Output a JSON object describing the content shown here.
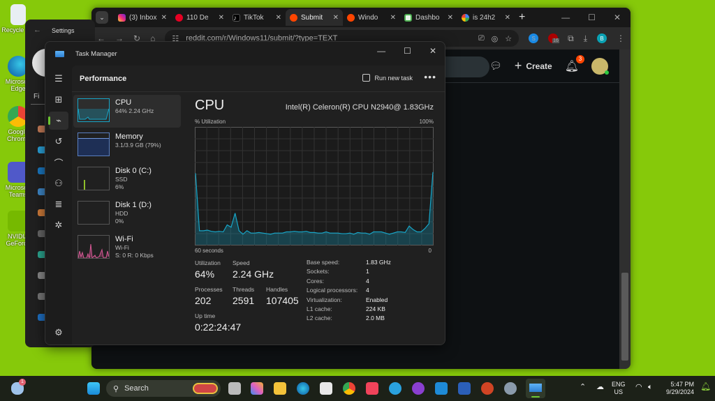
{
  "desktop": {
    "icons": [
      {
        "label": "Recycle Bin",
        "icon": "recycle-bin-icon"
      },
      {
        "label": "Microsoft Edge",
        "icon": "edge-icon"
      },
      {
        "label": "Google Chrome",
        "icon": "chrome-icon"
      },
      {
        "label": "Microsoft Teams",
        "icon": "teams-icon"
      },
      {
        "label": "NVIDIA GeForce",
        "icon": "nvidia-icon"
      }
    ]
  },
  "browser": {
    "tabs": [
      {
        "label": "(3) Inbox",
        "favicon": "instagram-icon",
        "color": "#d6249f"
      },
      {
        "label": "110 De",
        "favicon": "pinterest-icon",
        "color": "#e60023"
      },
      {
        "label": "TikTok",
        "favicon": "tiktok-icon",
        "color": "#111111"
      },
      {
        "label": "Submit",
        "favicon": "reddit-icon",
        "color": "#ff4500",
        "active": true
      },
      {
        "label": "Windo",
        "favicon": "reddit-icon",
        "color": "#ff4500"
      },
      {
        "label": "Dashbo",
        "favicon": "dashboard-icon",
        "color": "#4caf50"
      },
      {
        "label": "is 24h2",
        "favicon": "google-icon",
        "color": "#4285f4"
      }
    ],
    "new_tab": "+",
    "url": "reddit.com/r/Windows11/submit/?type=TEXT",
    "extension_badge": "16",
    "profile_initial": "B",
    "reddit": {
      "create_label": "Create",
      "notification_count": "3"
    }
  },
  "settings_window": {
    "title": "Settings",
    "search_partial": "Fi"
  },
  "task_manager": {
    "title": "Task Manager",
    "section": "Performance",
    "run_new_task": "Run new task",
    "more": "•••",
    "resources": [
      {
        "name": "CPU",
        "sub1": "64%  2.24 GHz",
        "sub2": "",
        "selected": true
      },
      {
        "name": "Memory",
        "sub1": "3.1/3.9 GB (79%)",
        "sub2": ""
      },
      {
        "name": "Disk 0 (C:)",
        "sub1": "SSD",
        "sub2": "6%"
      },
      {
        "name": "Disk 1 (D:)",
        "sub1": "HDD",
        "sub2": "0%"
      },
      {
        "name": "Wi-Fi",
        "sub1": "Wi-Fi",
        "sub2": "S: 0  R: 0 Kbps"
      }
    ],
    "detail": {
      "title": "CPU",
      "cpu_model": "Intel(R) Celeron(R) CPU N2940@ 1.83GHz",
      "y_label": "% Utilization",
      "y_max_label": "100%",
      "x_left_label": "60 seconds",
      "x_right_label": "0",
      "stats": {
        "utilization_label": "Utilization",
        "utilization": "64%",
        "speed_label": "Speed",
        "speed": "2.24 GHz",
        "processes_label": "Processes",
        "processes": "202",
        "threads_label": "Threads",
        "threads": "2591",
        "handles_label": "Handles",
        "handles": "107405",
        "uptime_label": "Up time",
        "uptime": "0:22:24:47"
      },
      "specs": [
        {
          "k": "Base speed:",
          "v": "1.83 GHz"
        },
        {
          "k": "Sockets:",
          "v": "1"
        },
        {
          "k": "Cores:",
          "v": "4"
        },
        {
          "k": "Logical processors:",
          "v": "4"
        },
        {
          "k": "Virtualization:",
          "v": "Enabled"
        },
        {
          "k": "L1 cache:",
          "v": "224 KB"
        },
        {
          "k": "L2 cache:",
          "v": "2.0 MB"
        }
      ]
    }
  },
  "chart_data": {
    "type": "area",
    "title": "CPU % Utilization",
    "xlabel": "60 seconds",
    "ylabel": "% Utilization",
    "ylim": [
      0,
      100
    ],
    "xlim": [
      60,
      0
    ],
    "grid": true,
    "color": "#17a6c8",
    "values": [
      61,
      12,
      12,
      12.5,
      11.5,
      11,
      11.5,
      11,
      17,
      15,
      27,
      12,
      9,
      12,
      10,
      10,
      10.5,
      10,
      9.5,
      9,
      10,
      10,
      10,
      11,
      11,
      11.5,
      11,
      11,
      11.5,
      10.5,
      10.5,
      10,
      10,
      11,
      10,
      10,
      10,
      9.5,
      9.5,
      10,
      9,
      10.5,
      10,
      10,
      9,
      11,
      11,
      11,
      10,
      9,
      10,
      11,
      11,
      10.5,
      16,
      13,
      11,
      11,
      14,
      18,
      62
    ]
  },
  "taskbar": {
    "weather_badge": "1",
    "search_placeholder": "Search",
    "apps": [
      "task-view",
      "copilot",
      "file-explorer",
      "edge",
      "store",
      "chrome",
      "apple-music",
      "telegram",
      "github-desktop",
      "vscode",
      "word",
      "powerpoint",
      "settings",
      "task-manager"
    ],
    "lang_line1": "ENG",
    "lang_line2": "US",
    "time": "5:47 PM",
    "date": "9/29/2024"
  }
}
